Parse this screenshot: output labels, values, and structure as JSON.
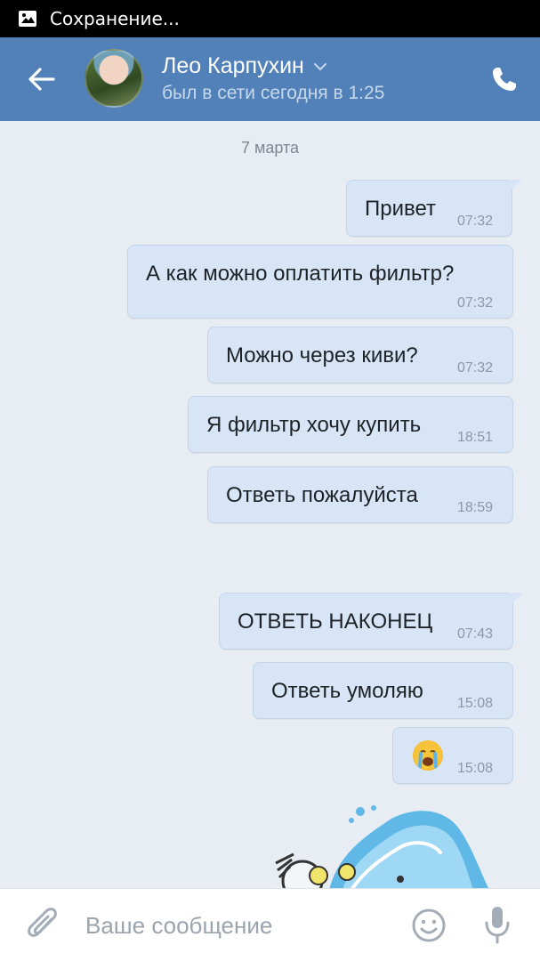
{
  "status_bar": {
    "text": "Сохранение...",
    "icon": "image-icon"
  },
  "header": {
    "back_icon": "arrow-left-icon",
    "contact_name": "Лео Карпухин",
    "contact_status": "был в сети сегодня в 1:25",
    "call_icon": "phone-icon",
    "accent_color": "#5181b8"
  },
  "chat": {
    "date_separator": "7 марта",
    "messages": [
      {
        "text": "Привет",
        "time": "07:32"
      },
      {
        "text": "А как можно оплатить фильтр?",
        "time": "07:32"
      },
      {
        "text": "Можно через киви?",
        "time": "07:32"
      },
      {
        "text": "Я фильтр хочу купить",
        "time": "18:51"
      },
      {
        "text": "Ответь пожалуйста",
        "time": "18:59"
      },
      {
        "text": "ОТВЕТЬ НАКОНЕЦ",
        "time": "07:43"
      },
      {
        "text": "Ответь умоляю",
        "time": "15:08"
      },
      {
        "emoji": "crying-face-emoji",
        "time": "15:08"
      }
    ],
    "bubble_color": "#d7e5f6",
    "sticker": "water-splash-sticker"
  },
  "composer": {
    "attach_icon": "paperclip-icon",
    "placeholder": "Ваше сообщение",
    "emoji_icon": "smile-icon",
    "mic_icon": "microphone-icon"
  }
}
